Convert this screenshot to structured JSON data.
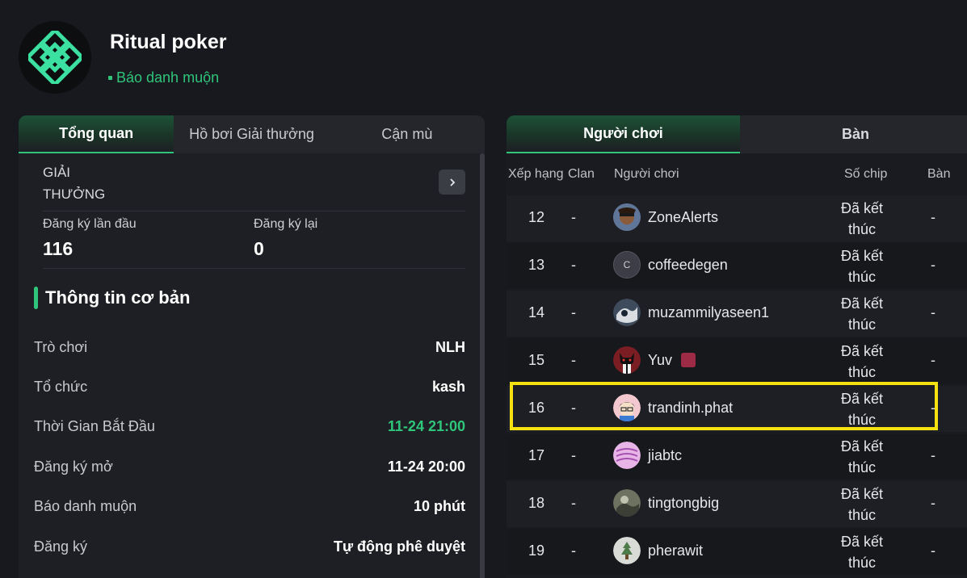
{
  "header": {
    "title": "Ritual poker",
    "status": "Báo danh muộn",
    "logo_icon": "ritual-knot-logo",
    "accent_color": "#2fc57a"
  },
  "left_tabs": [
    {
      "label": "Tổng quan",
      "active": true
    },
    {
      "label": "Hồ bơi Giải thưởng",
      "active": false
    },
    {
      "label": "Cận mù",
      "active": false
    }
  ],
  "prize": {
    "label": "GIẢI THƯỞNG",
    "button_icon": "chevron-right-icon"
  },
  "registration": {
    "first_label": "Đăng ký lần đầu",
    "first_value": "116",
    "re_label": "Đăng ký lại",
    "re_value": "0"
  },
  "basic_info": {
    "heading": "Thông tin cơ bản",
    "rows": [
      {
        "key": "Trò chơi",
        "value": "NLH"
      },
      {
        "key": "Tổ chức",
        "value": "kash"
      },
      {
        "key": "Thời Gian Bắt Đầu",
        "value": "11-24 21:00"
      },
      {
        "key": "Đăng ký mở",
        "value": "11-24 20:00"
      },
      {
        "key": "Báo danh muộn",
        "value": "10 phút"
      },
      {
        "key": "Đăng ký",
        "value": "Tự động phê duyệt"
      }
    ]
  },
  "right_tabs": [
    {
      "label": "Người chơi",
      "active": true
    },
    {
      "label": "Bàn",
      "active": false
    }
  ],
  "players_table": {
    "columns": [
      "Xếp hạng",
      "Clan",
      "Người chơi",
      "Số chip",
      "Bàn"
    ],
    "rows": [
      {
        "rank": "12",
        "clan": "-",
        "player": "ZoneAlerts",
        "status": "Đã kết thúc",
        "table": "-"
      },
      {
        "rank": "13",
        "clan": "-",
        "player": "coffeedegen",
        "status": "Đã kết thúc",
        "table": "-"
      },
      {
        "rank": "14",
        "clan": "-",
        "player": "muzammilyaseen1",
        "status": "Đã kết thúc",
        "table": "-"
      },
      {
        "rank": "15",
        "clan": "-",
        "player": "Yuv",
        "status": "Đã kết thúc",
        "table": "-"
      },
      {
        "rank": "16",
        "clan": "-",
        "player": "trandinh.phat",
        "status": "Đã kết thúc",
        "table": "-"
      },
      {
        "rank": "17",
        "clan": "-",
        "player": "jiabtc",
        "status": "Đã kết thúc",
        "table": "-"
      },
      {
        "rank": "18",
        "clan": "-",
        "player": "tingtongbig",
        "status": "Đã kết thúc",
        "table": "-"
      },
      {
        "rank": "19",
        "clan": "-",
        "player": "pherawit",
        "status": "Đã kết thúc",
        "table": "-"
      }
    ],
    "avatar_letter_13": "C",
    "highlight_color": "#f5e010"
  }
}
